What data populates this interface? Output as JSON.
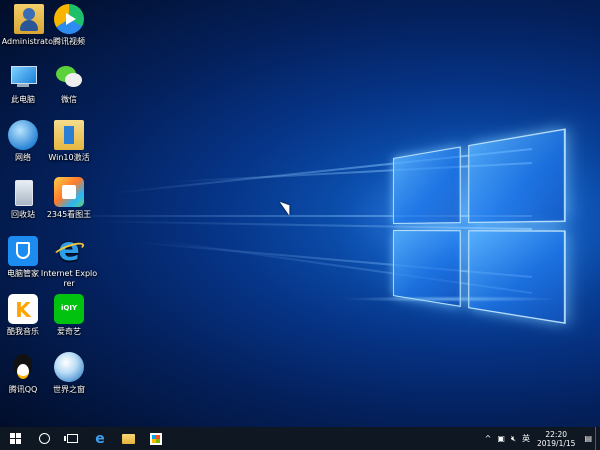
{
  "desktop": {
    "icons": [
      {
        "label": "Administrator",
        "icon": "user-folder-icon"
      },
      {
        "label": "腾讯视频",
        "icon": "tencent-video-icon"
      },
      {
        "label": "此电脑",
        "icon": "computer-icon"
      },
      {
        "label": "微信",
        "icon": "wechat-icon"
      },
      {
        "label": "网络",
        "icon": "network-globe-icon"
      },
      {
        "label": "Win10激活",
        "icon": "win10-activation-icon"
      },
      {
        "label": "回收站",
        "icon": "recycle-bin-icon"
      },
      {
        "label": "2345看图王",
        "icon": "image-viewer-icon"
      },
      {
        "label": "电脑管家",
        "icon": "pc-manager-shield-icon"
      },
      {
        "label": "Internet Explorer",
        "icon": "internet-explorer-icon"
      },
      {
        "label": "酷我音乐",
        "icon": "music-player-icon"
      },
      {
        "label": "爱奇艺",
        "icon": "iqiyi-icon"
      },
      {
        "label": "腾讯QQ",
        "icon": "qq-penguin-icon"
      },
      {
        "label": "世界之窗",
        "icon": "world-browser-icon"
      }
    ]
  },
  "taskbar": {
    "start": "windows-start-icon",
    "search": "search-circle-icon",
    "task_view": "task-view-icon",
    "pinned": [
      "edge-icon",
      "file-explorer-icon",
      "store-icon"
    ],
    "tray": {
      "expand": "^",
      "network_icon": "network-icon",
      "volume_icon": "speaker-muted-icon",
      "ime": "英",
      "notification_icon": "notification-icon"
    },
    "clock": {
      "time": "22:20",
      "date": "2019/1/15"
    }
  },
  "colors": {
    "accent": "#1a7fd8",
    "taskbar": "#0f1722"
  }
}
